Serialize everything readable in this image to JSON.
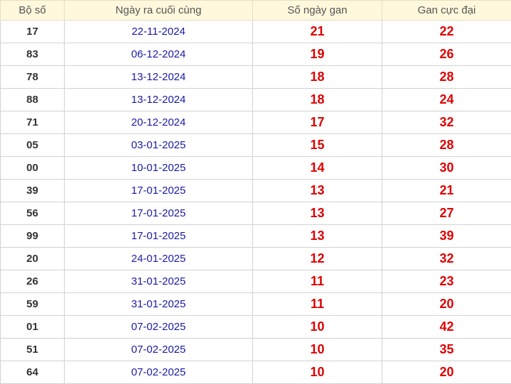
{
  "table": {
    "headers": {
      "bo_so": "Bộ số",
      "ngay_ra": "Ngày ra cuối cùng",
      "so_ngay_gan": "Số ngày gan",
      "gan_cuc_dai": "Gan cực đại"
    },
    "rows": [
      {
        "bo_so": "17",
        "ngay_ra": "22-11-2024",
        "so_ngay_gan": "21",
        "gan_cuc_dai": "22"
      },
      {
        "bo_so": "83",
        "ngay_ra": "06-12-2024",
        "so_ngay_gan": "19",
        "gan_cuc_dai": "26"
      },
      {
        "bo_so": "78",
        "ngay_ra": "13-12-2024",
        "so_ngay_gan": "18",
        "gan_cuc_dai": "28"
      },
      {
        "bo_so": "88",
        "ngay_ra": "13-12-2024",
        "so_ngay_gan": "18",
        "gan_cuc_dai": "24"
      },
      {
        "bo_so": "71",
        "ngay_ra": "20-12-2024",
        "so_ngay_gan": "17",
        "gan_cuc_dai": "32"
      },
      {
        "bo_so": "05",
        "ngay_ra": "03-01-2025",
        "so_ngay_gan": "15",
        "gan_cuc_dai": "28"
      },
      {
        "bo_so": "00",
        "ngay_ra": "10-01-2025",
        "so_ngay_gan": "14",
        "gan_cuc_dai": "30"
      },
      {
        "bo_so": "39",
        "ngay_ra": "17-01-2025",
        "so_ngay_gan": "13",
        "gan_cuc_dai": "21"
      },
      {
        "bo_so": "56",
        "ngay_ra": "17-01-2025",
        "so_ngay_gan": "13",
        "gan_cuc_dai": "27"
      },
      {
        "bo_so": "99",
        "ngay_ra": "17-01-2025",
        "so_ngay_gan": "13",
        "gan_cuc_dai": "39"
      },
      {
        "bo_so": "20",
        "ngay_ra": "24-01-2025",
        "so_ngay_gan": "12",
        "gan_cuc_dai": "32"
      },
      {
        "bo_so": "26",
        "ngay_ra": "31-01-2025",
        "so_ngay_gan": "11",
        "gan_cuc_dai": "23"
      },
      {
        "bo_so": "59",
        "ngay_ra": "31-01-2025",
        "so_ngay_gan": "11",
        "gan_cuc_dai": "20"
      },
      {
        "bo_so": "01",
        "ngay_ra": "07-02-2025",
        "so_ngay_gan": "10",
        "gan_cuc_dai": "42"
      },
      {
        "bo_so": "51",
        "ngay_ra": "07-02-2025",
        "so_ngay_gan": "10",
        "gan_cuc_dai": "35"
      },
      {
        "bo_so": "64",
        "ngay_ra": "07-02-2025",
        "so_ngay_gan": "10",
        "gan_cuc_dai": "20"
      }
    ]
  },
  "colors": {
    "header_bg": "#fff8dc",
    "number": "#e00000",
    "date": "#1a1aa6",
    "text": "#333333"
  }
}
